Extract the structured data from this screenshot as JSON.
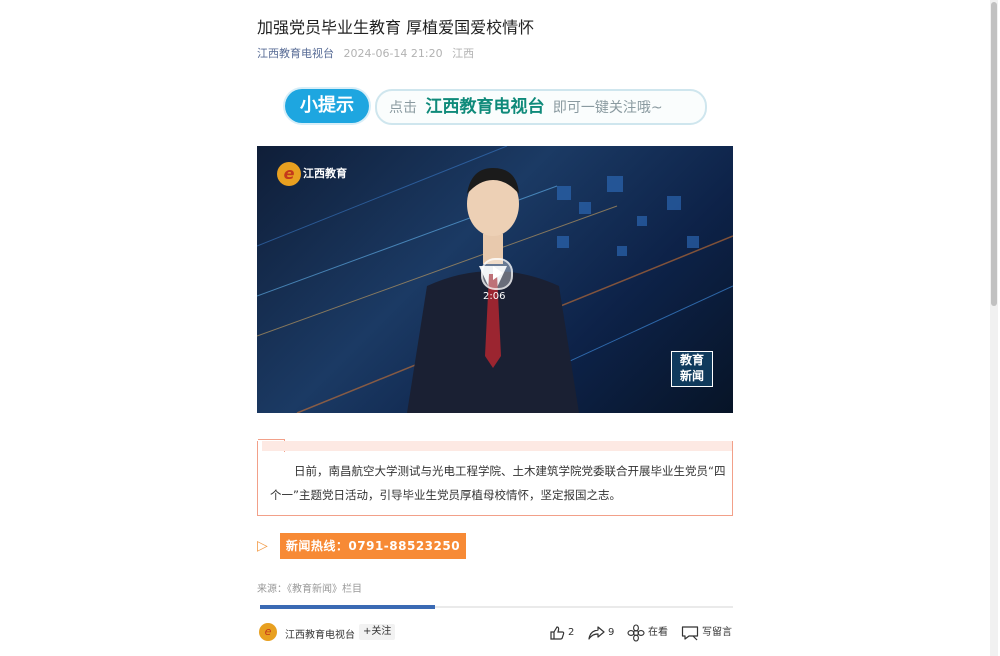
{
  "article": {
    "title": "加强党员毕业生教育 厚植爱国爱校情怀",
    "account": "江西教育电视台",
    "datetime": "2024-06-14 21:20",
    "location": "江西"
  },
  "banner": {
    "tip": "小提示",
    "prefix": "点击",
    "channel": "江西教育电视台",
    "suffix": "即可一键关注哦~"
  },
  "video": {
    "logo_text": "江西教育",
    "badge_line1": "教育",
    "badge_line2": "新闻",
    "duration": "2:06",
    "icons": [
      "play-icon"
    ]
  },
  "body": {
    "paragraph": "日前，南昌航空大学测试与光电工程学院、土木建筑学院党委联合开展毕业生党员“四个一”主题党日活动，引导毕业生党员厚植母校情怀，坚定报国之志。"
  },
  "hotline": {
    "label": "新闻热线：0791-88523250"
  },
  "source": "来源：《教育新闻》栏目",
  "progress": {
    "fraction": 0.37,
    "color": "#3a6ab4"
  },
  "footer": {
    "account": "江西教育电视台",
    "follow": "+关注",
    "like_count": "2",
    "share_count": "9",
    "watching": "在看",
    "comment": "写留言",
    "icons": [
      "thumbs-up-icon",
      "share-icon",
      "flower-icon",
      "comment-icon"
    ]
  },
  "colors": {
    "accent": "#f78a35",
    "link": "#576b95",
    "brand_teal": "#0f8a7a",
    "tip_blue": "#1ea6e0"
  }
}
